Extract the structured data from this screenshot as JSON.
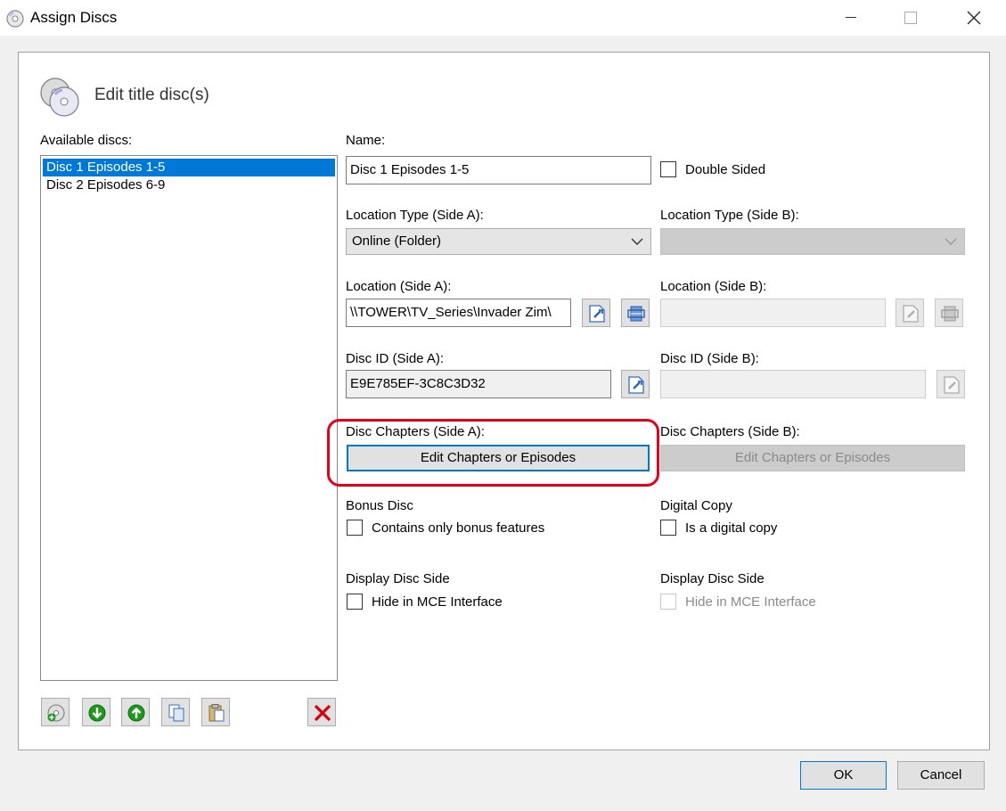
{
  "window": {
    "title": "Assign Discs",
    "close_glyph": "✕"
  },
  "header": {
    "title": "Edit title disc(s)",
    "icon": "discs-icon"
  },
  "available_discs": {
    "label": "Available discs:",
    "items": [
      "Disc 1 Episodes 1-5",
      "Disc 2 Episodes 6-9"
    ],
    "selected_index": 0
  },
  "name": {
    "label": "Name:",
    "value": "Disc 1 Episodes 1-5",
    "double_sided_label": "Double Sided",
    "double_sided_checked": false
  },
  "side_a": {
    "location_type_label": "Location Type (Side A):",
    "location_type_value": "Online (Folder)",
    "location_label": "Location (Side A):",
    "location_value": "\\\\TOWER\\TV_Series\\Invader Zim\\",
    "disc_id_label": "Disc ID (Side A):",
    "disc_id_value": "E9E785EF-3C8C3D32",
    "chapters_label": "Disc Chapters (Side A):",
    "chapters_button": "Edit Chapters or Episodes"
  },
  "side_b": {
    "location_type_label": "Location Type (Side B):",
    "location_type_value": "",
    "location_label": "Location (Side B):",
    "location_value": "",
    "disc_id_label": "Disc ID (Side B):",
    "disc_id_value": "",
    "chapters_label": "Disc Chapters (Side B):",
    "chapters_button": "Edit Chapters or Episodes"
  },
  "bonus": {
    "label": "Bonus Disc",
    "checkbox_label": "Contains only bonus features",
    "checked": false
  },
  "digital": {
    "label": "Digital Copy",
    "checkbox_label": "Is a digital copy",
    "checked": false
  },
  "display_a": {
    "label": "Display Disc Side",
    "checkbox_label": "Hide in MCE Interface",
    "checked": false
  },
  "display_b": {
    "label": "Display Disc Side",
    "checkbox_label": "Hide in MCE Interface",
    "checked": false
  },
  "footer": {
    "ok_label": "OK",
    "cancel_label": "Cancel"
  },
  "colors": {
    "selection": "#0078d7",
    "highlight_ring": "#e2001a",
    "delete_red": "#d9000d",
    "arrow_green": "#1e9a1e"
  }
}
